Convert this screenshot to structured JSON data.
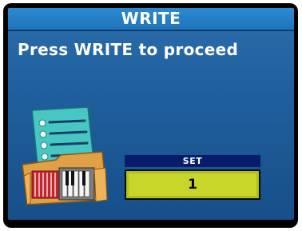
{
  "title": "WRITE",
  "message": "Press WRITE to proceed",
  "set": {
    "label": "SET",
    "value": "1"
  },
  "icon": "accordion-writing-icon",
  "colors": {
    "screen_bg": "#1f5f9e",
    "titlebar_bg": "#1f74bc",
    "set_label_bg": "#091c6b",
    "set_field_bg": "#c7d628"
  }
}
